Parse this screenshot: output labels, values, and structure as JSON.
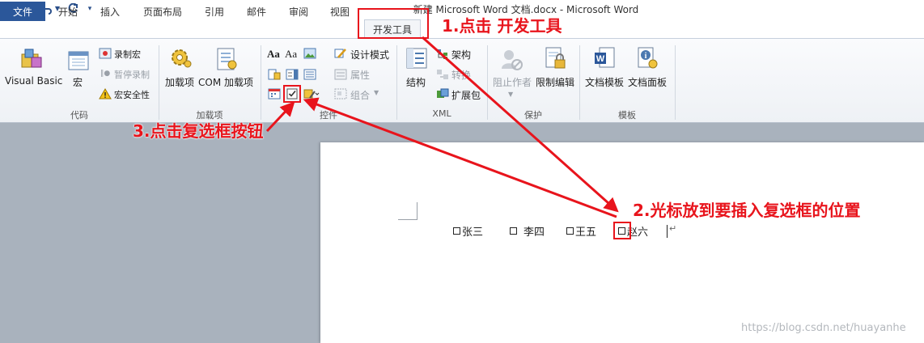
{
  "title": "新建 Microsoft Word 文档.docx - Microsoft Word",
  "qat": {
    "app_icon": "W"
  },
  "tabs": [
    {
      "label": "文件"
    },
    {
      "label": "开始"
    },
    {
      "label": "插入"
    },
    {
      "label": "页面布局"
    },
    {
      "label": "引用"
    },
    {
      "label": "邮件"
    },
    {
      "label": "审阅"
    },
    {
      "label": "视图"
    },
    {
      "label": "开发工具"
    }
  ],
  "groups": {
    "code": {
      "label": "代码",
      "visual_basic": "Visual Basic",
      "macro": "宏",
      "record_macro": "录制宏",
      "pause_record": "暂停录制",
      "macro_security": "宏安全性"
    },
    "addins": {
      "label": "加载项",
      "addins": "加载项",
      "com_addins": "COM 加载项"
    },
    "controls": {
      "label": "控件",
      "aa1": "Aa",
      "aa2": "Aa",
      "design_mode": "设计模式",
      "properties": "属性",
      "group": "组合"
    },
    "xml": {
      "label": "XML",
      "structure": "结构",
      "schema": "架构",
      "transform": "转换",
      "expansion": "扩展包"
    },
    "protect": {
      "label": "保护",
      "block_authors": "阻止作者",
      "restrict_editing": "限制编辑"
    },
    "templates": {
      "label": "模板",
      "doc_template": "文档模板",
      "doc_panel": "文档面板"
    }
  },
  "document": {
    "names": [
      "张三",
      "李四",
      "王五",
      "赵六"
    ]
  },
  "annotations": {
    "step1": "1.点击 开发工具",
    "step2": "2.光标放到要插入复选框的位置",
    "step3": "3.点击复选框按钮"
  },
  "watermark": "https://blog.csdn.net/huayanhe",
  "colors": {
    "accent": "#2b579a",
    "annotation": "#e8141c"
  }
}
